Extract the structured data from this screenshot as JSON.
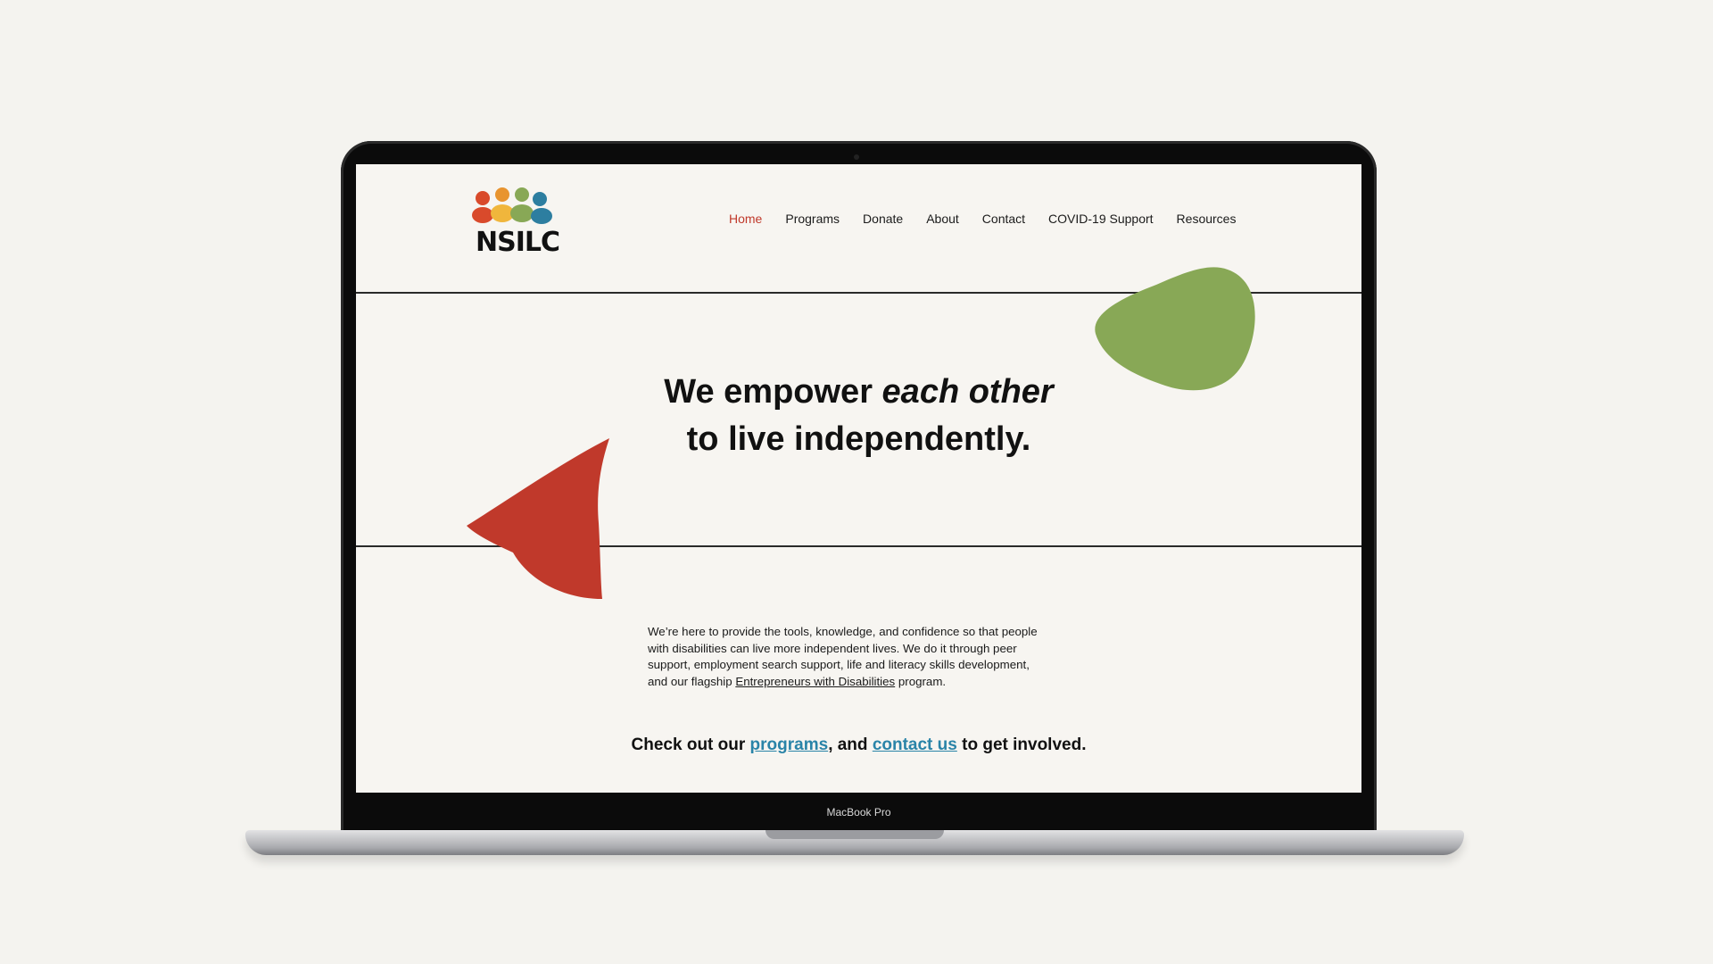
{
  "device": {
    "label": "MacBook Pro"
  },
  "site": {
    "logo_text": "NSILC",
    "nav": [
      {
        "label": "Home",
        "active": true
      },
      {
        "label": "Programs"
      },
      {
        "label": "Donate"
      },
      {
        "label": "About"
      },
      {
        "label": "Contact"
      },
      {
        "label": "COVID-19 Support"
      },
      {
        "label": "Resources"
      }
    ],
    "hero": {
      "line1_plain": "We empower ",
      "line1_italic": "each other",
      "line2": "to live independently."
    },
    "body": {
      "text_before_link": "We’re here to provide the tools, knowledge, and confidence so that people with disabilities can live more independent lives. We do it through peer support, employment search support, life and literacy skills development, and our flagship ",
      "link_text": "Entrepreneurs with Disabilities",
      "text_after_link": " program."
    },
    "cta": {
      "prefix": "Check out our ",
      "programs_link": "programs",
      "middle": ", and ",
      "contact_link": "contact us",
      "suffix": " to get involved."
    }
  },
  "colors": {
    "accent_red": "#c0392b",
    "accent_green": "#88a856",
    "link_blue": "#2a84a8",
    "logo_orange": "#e8842f",
    "logo_yellow": "#f0b63c",
    "logo_teal": "#2d7ea0"
  },
  "icons": [
    "people-group-logo-icon"
  ]
}
